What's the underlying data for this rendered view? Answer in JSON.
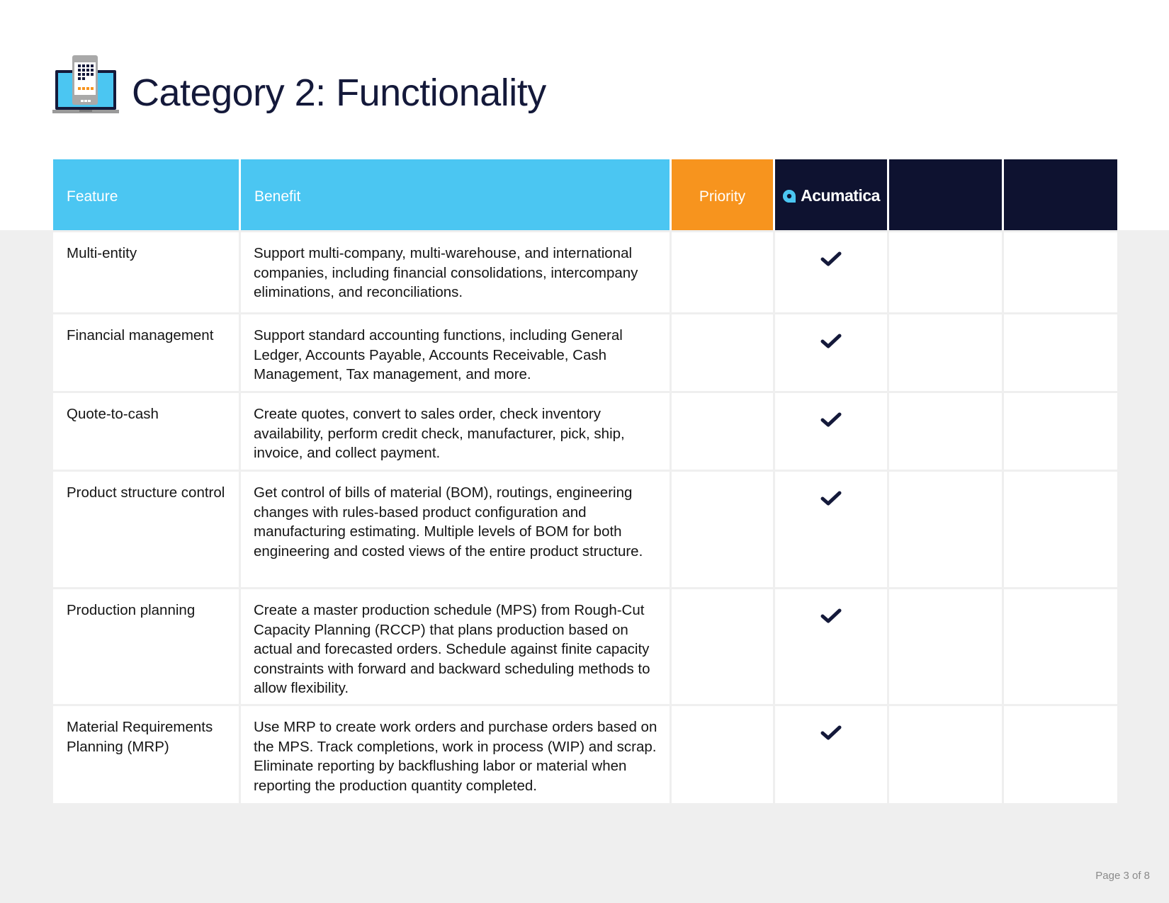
{
  "page": {
    "title": "Category 2: Functionality",
    "page_number": "Page 3 of 8",
    "icon": "laptop-phone-icon"
  },
  "colors": {
    "header_cyan": "#4bc6f2",
    "header_orange": "#f7941e",
    "header_navy": "#0e1230",
    "title_navy": "#14193a",
    "brand_blue": "#4bc6f2",
    "band_gray": "#efefef"
  },
  "table": {
    "headers": {
      "feature": "Feature",
      "benefit": "Benefit",
      "priority": "Priority",
      "vendor_1": "Acumatica",
      "vendor_2": "",
      "vendor_3": ""
    },
    "rows": [
      {
        "feature": "Multi-entity",
        "benefit": "Support multi-company, multi-warehouse, and international companies, including financial consolidations, intercompany eliminations, and reconciliations.",
        "priority": "",
        "vendor_1": "check",
        "vendor_2": "",
        "vendor_3": ""
      },
      {
        "feature": "Financial management",
        "benefit": "Support standard accounting functions, including General Ledger, Accounts Payable, Accounts Receivable, Cash Management, Tax management, and more.",
        "priority": "",
        "vendor_1": "check",
        "vendor_2": "",
        "vendor_3": ""
      },
      {
        "feature": "Quote-to-cash",
        "benefit": "Create quotes, convert to sales order, check inventory availability, perform credit check, manufacturer, pick, ship, invoice, and collect payment.",
        "priority": "",
        "vendor_1": "check",
        "vendor_2": "",
        "vendor_3": ""
      },
      {
        "feature": "Product structure control",
        "benefit": "Get control of bills of material (BOM), routings, engineering changes with rules-based product configuration and manufacturing estimating. Multiple levels of BOM for both engineering and costed views of the entire product structure.",
        "priority": "",
        "vendor_1": "check",
        "vendor_2": "",
        "vendor_3": ""
      },
      {
        "feature": "Production planning",
        "benefit": "Create a master production schedule (MPS) from Rough-Cut Capacity Planning (RCCP) that plans production based on actual and forecasted orders. Schedule against finite capacity constraints with forward and backward scheduling methods to allow flexibility.",
        "priority": "",
        "vendor_1": "check",
        "vendor_2": "",
        "vendor_3": ""
      },
      {
        "feature": "Material Requirements Planning (MRP)",
        "benefit": "Use MRP to create work orders and purchase orders based on the MPS. Track completions, work in process (WIP) and scrap. Eliminate reporting by backflushing labor or material when reporting the production quantity completed.",
        "priority": "",
        "vendor_1": "check",
        "vendor_2": "",
        "vendor_3": ""
      }
    ]
  }
}
